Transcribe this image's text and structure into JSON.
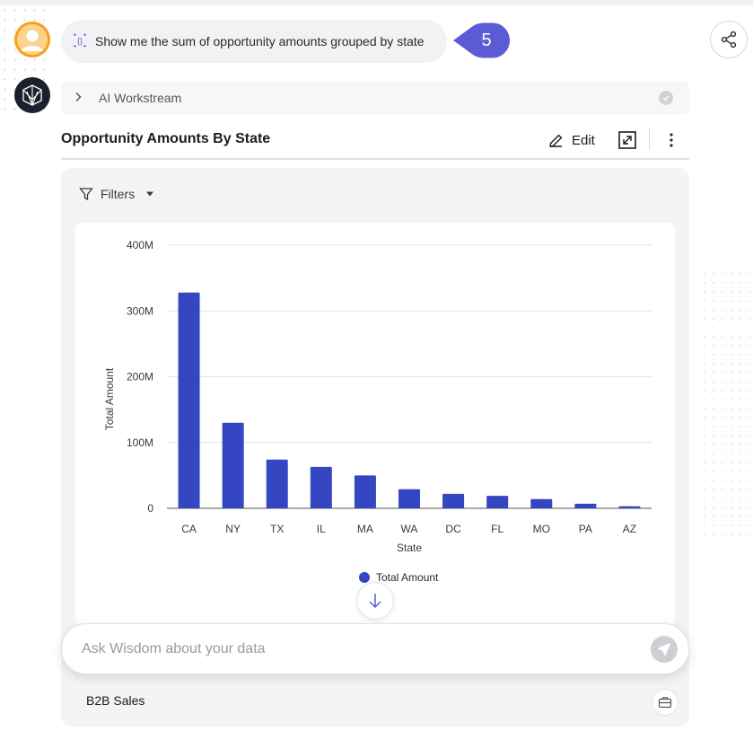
{
  "conversation": {
    "query_text": "Show me the sum of opportunity amounts grouped by state",
    "query_number": "5",
    "workstream_label": "AI Workstream"
  },
  "chart_header": {
    "title": "Opportunity Amounts By State",
    "edit_label": "Edit"
  },
  "filters": {
    "label": "Filters"
  },
  "chart_data": {
    "type": "bar",
    "categories": [
      "CA",
      "NY",
      "TX",
      "IL",
      "MA",
      "WA",
      "DC",
      "FL",
      "MO",
      "PA",
      "AZ"
    ],
    "series": [
      {
        "name": "Total Amount",
        "values": [
          328,
          130,
          74,
          63,
          50,
          29,
          22,
          19,
          14,
          7,
          3
        ],
        "color": "#3446c2"
      }
    ],
    "value_unit": "M",
    "xlabel": "State",
    "ylabel": "Total Amount",
    "ylim": [
      0,
      400
    ],
    "yticks": [
      {
        "value": 0,
        "label": "0"
      },
      {
        "value": 100,
        "label": "100M"
      },
      {
        "value": 200,
        "label": "200M"
      },
      {
        "value": 300,
        "label": "300M"
      },
      {
        "value": 400,
        "label": "400M"
      }
    ],
    "grid": true,
    "legend": "bottom"
  },
  "ask": {
    "placeholder": "Ask Wisdom about your data"
  },
  "dataset": {
    "name": "B2B Sales"
  },
  "colors": {
    "accent": "#5b5bd6",
    "bar": "#3446c2",
    "avatar_user": "#f7a11a",
    "avatar_bot": "#1d1f2e"
  },
  "icons": {
    "user": "user-avatar-icon",
    "bot": "wisdom-logo-icon",
    "query": "ai-query-icon",
    "share": "share-icon",
    "chevron": "chevron-right-icon",
    "check": "check-circle-icon",
    "edit": "pencil-icon",
    "expand": "expand-icon",
    "more": "more-vertical-icon",
    "filter": "filter-icon",
    "caret": "caret-down-icon",
    "scroll": "arrow-down-icon",
    "send": "send-icon",
    "dataset": "briefcase-icon"
  }
}
